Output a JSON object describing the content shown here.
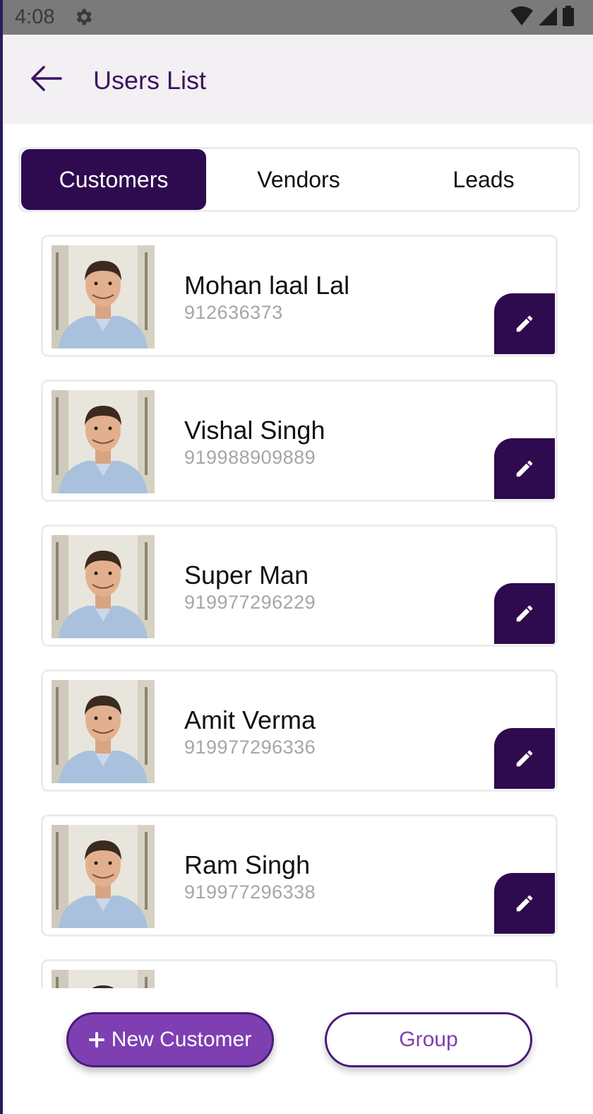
{
  "status_bar": {
    "time": "4:08",
    "icons": [
      "settings-icon",
      "wifi-icon",
      "signal-icon",
      "battery-icon"
    ]
  },
  "app_bar": {
    "title": "Users List",
    "back_icon": "arrow-left-icon"
  },
  "tabs": [
    {
      "label": "Customers",
      "active": true
    },
    {
      "label": "Vendors",
      "active": false
    },
    {
      "label": "Leads",
      "active": false
    }
  ],
  "users": [
    {
      "name": "Mohan laal Lal",
      "phone": "912636373"
    },
    {
      "name": "Vishal Singh",
      "phone": "919988909889"
    },
    {
      "name": "Super Man",
      "phone": "919977296229"
    },
    {
      "name": "Amit Verma",
      "phone": "919977296336"
    },
    {
      "name": "Ram Singh",
      "phone": "919977296338"
    }
  ],
  "actions": {
    "new_customer_label": "New Customer",
    "group_label": "Group"
  },
  "colors": {
    "primary_dark": "#2e0a4e",
    "primary": "#7e3fb2",
    "title": "#3d1260"
  }
}
